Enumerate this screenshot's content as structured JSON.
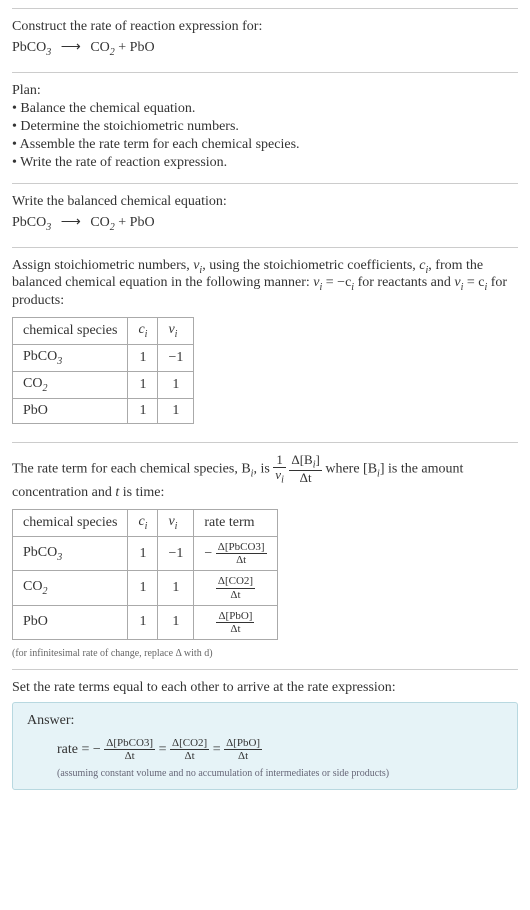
{
  "chart_data": {
    "type": "table",
    "tables": [
      {
        "title": "Stoichiometric numbers",
        "columns": [
          "chemical species",
          "c_i",
          "ν_i"
        ],
        "rows": [
          [
            "PbCO₃",
            1,
            -1
          ],
          [
            "CO₂",
            1,
            1
          ],
          [
            "PbO",
            1,
            1
          ]
        ]
      },
      {
        "title": "Rate terms",
        "columns": [
          "chemical species",
          "c_i",
          "ν_i",
          "rate term"
        ],
        "rows": [
          [
            "PbCO₃",
            1,
            -1,
            "-Δ[PbCO₃]/Δt"
          ],
          [
            "CO₂",
            1,
            1,
            "Δ[CO₂]/Δt"
          ],
          [
            "PbO",
            1,
            1,
            "Δ[PbO]/Δt"
          ]
        ]
      }
    ]
  },
  "header": {
    "prompt": "Construct the rate of reaction expression for:",
    "equation_lhs": "PbCO",
    "equation_lhs_sub": "3",
    "equation_rhs1": "CO",
    "equation_rhs1_sub": "2",
    "equation_rhs2": "PbO"
  },
  "plan": {
    "title": "Plan:",
    "items": [
      "Balance the chemical equation.",
      "Determine the stoichiometric numbers.",
      "Assemble the rate term for each chemical species.",
      "Write the rate of reaction expression."
    ]
  },
  "balanced": {
    "title": "Write the balanced chemical equation:"
  },
  "stoich": {
    "intro1": "Assign stoichiometric numbers, ",
    "intro2": ", using the stoichiometric coefficients, ",
    "intro3": ", from the balanced chemical equation in the following manner: ",
    "intro4": " for reactants and ",
    "intro5": " for products:",
    "nu_i": "ν",
    "c_i": "c",
    "eq1": "ν",
    "eq1b": " = −c",
    "eq2": "ν",
    "eq2b": " = c",
    "table": {
      "h1": "chemical species",
      "h2": "c",
      "h3": "ν",
      "r1c1": "PbCO",
      "r1c1_sub": "3",
      "r1c2": "1",
      "r1c3": "−1",
      "r2c1": "CO",
      "r2c1_sub": "2",
      "r2c2": "1",
      "r2c3": "1",
      "r3c1": "PbO",
      "r3c2": "1",
      "r3c3": "1"
    }
  },
  "rateterm": {
    "intro1": "The rate term for each chemical species, B",
    "intro2": ", is ",
    "intro3": " where [B",
    "intro4": "] is the amount concentration and ",
    "intro5": " is time:",
    "t_var": "t",
    "frac1_num": "1",
    "frac2_num": "Δ[B",
    "frac2_num2": "]",
    "frac_den_nu": "ν",
    "frac_den_dt": "Δt",
    "table": {
      "h1": "chemical species",
      "h2": "c",
      "h3": "ν",
      "h4": "rate term",
      "r1c1": "PbCO",
      "r1c1_sub": "3",
      "r1c2": "1",
      "r1c3": "−1",
      "r1c4_neg": "−",
      "r1c4_num": "Δ[PbCO3]",
      "r1c4_den": "Δt",
      "r2c1": "CO",
      "r2c1_sub": "2",
      "r2c2": "1",
      "r2c3": "1",
      "r2c4_num": "Δ[CO2]",
      "r2c4_den": "Δt",
      "r3c1": "PbO",
      "r3c2": "1",
      "r3c3": "1",
      "r3c4_num": "Δ[PbO]",
      "r3c4_den": "Δt"
    },
    "footnote": "(for infinitesimal rate of change, replace Δ with d)"
  },
  "final": {
    "intro": "Set the rate terms equal to each other to arrive at the rate expression:"
  },
  "answer": {
    "title": "Answer:",
    "rate_label": "rate = −",
    "eq": " = ",
    "t1_num": "Δ[PbCO3]",
    "t1_den": "Δt",
    "t2_num": "Δ[CO2]",
    "t2_den": "Δt",
    "t3_num": "Δ[PbO]",
    "t3_den": "Δt",
    "note": "(assuming constant volume and no accumulation of intermediates or side products)"
  }
}
